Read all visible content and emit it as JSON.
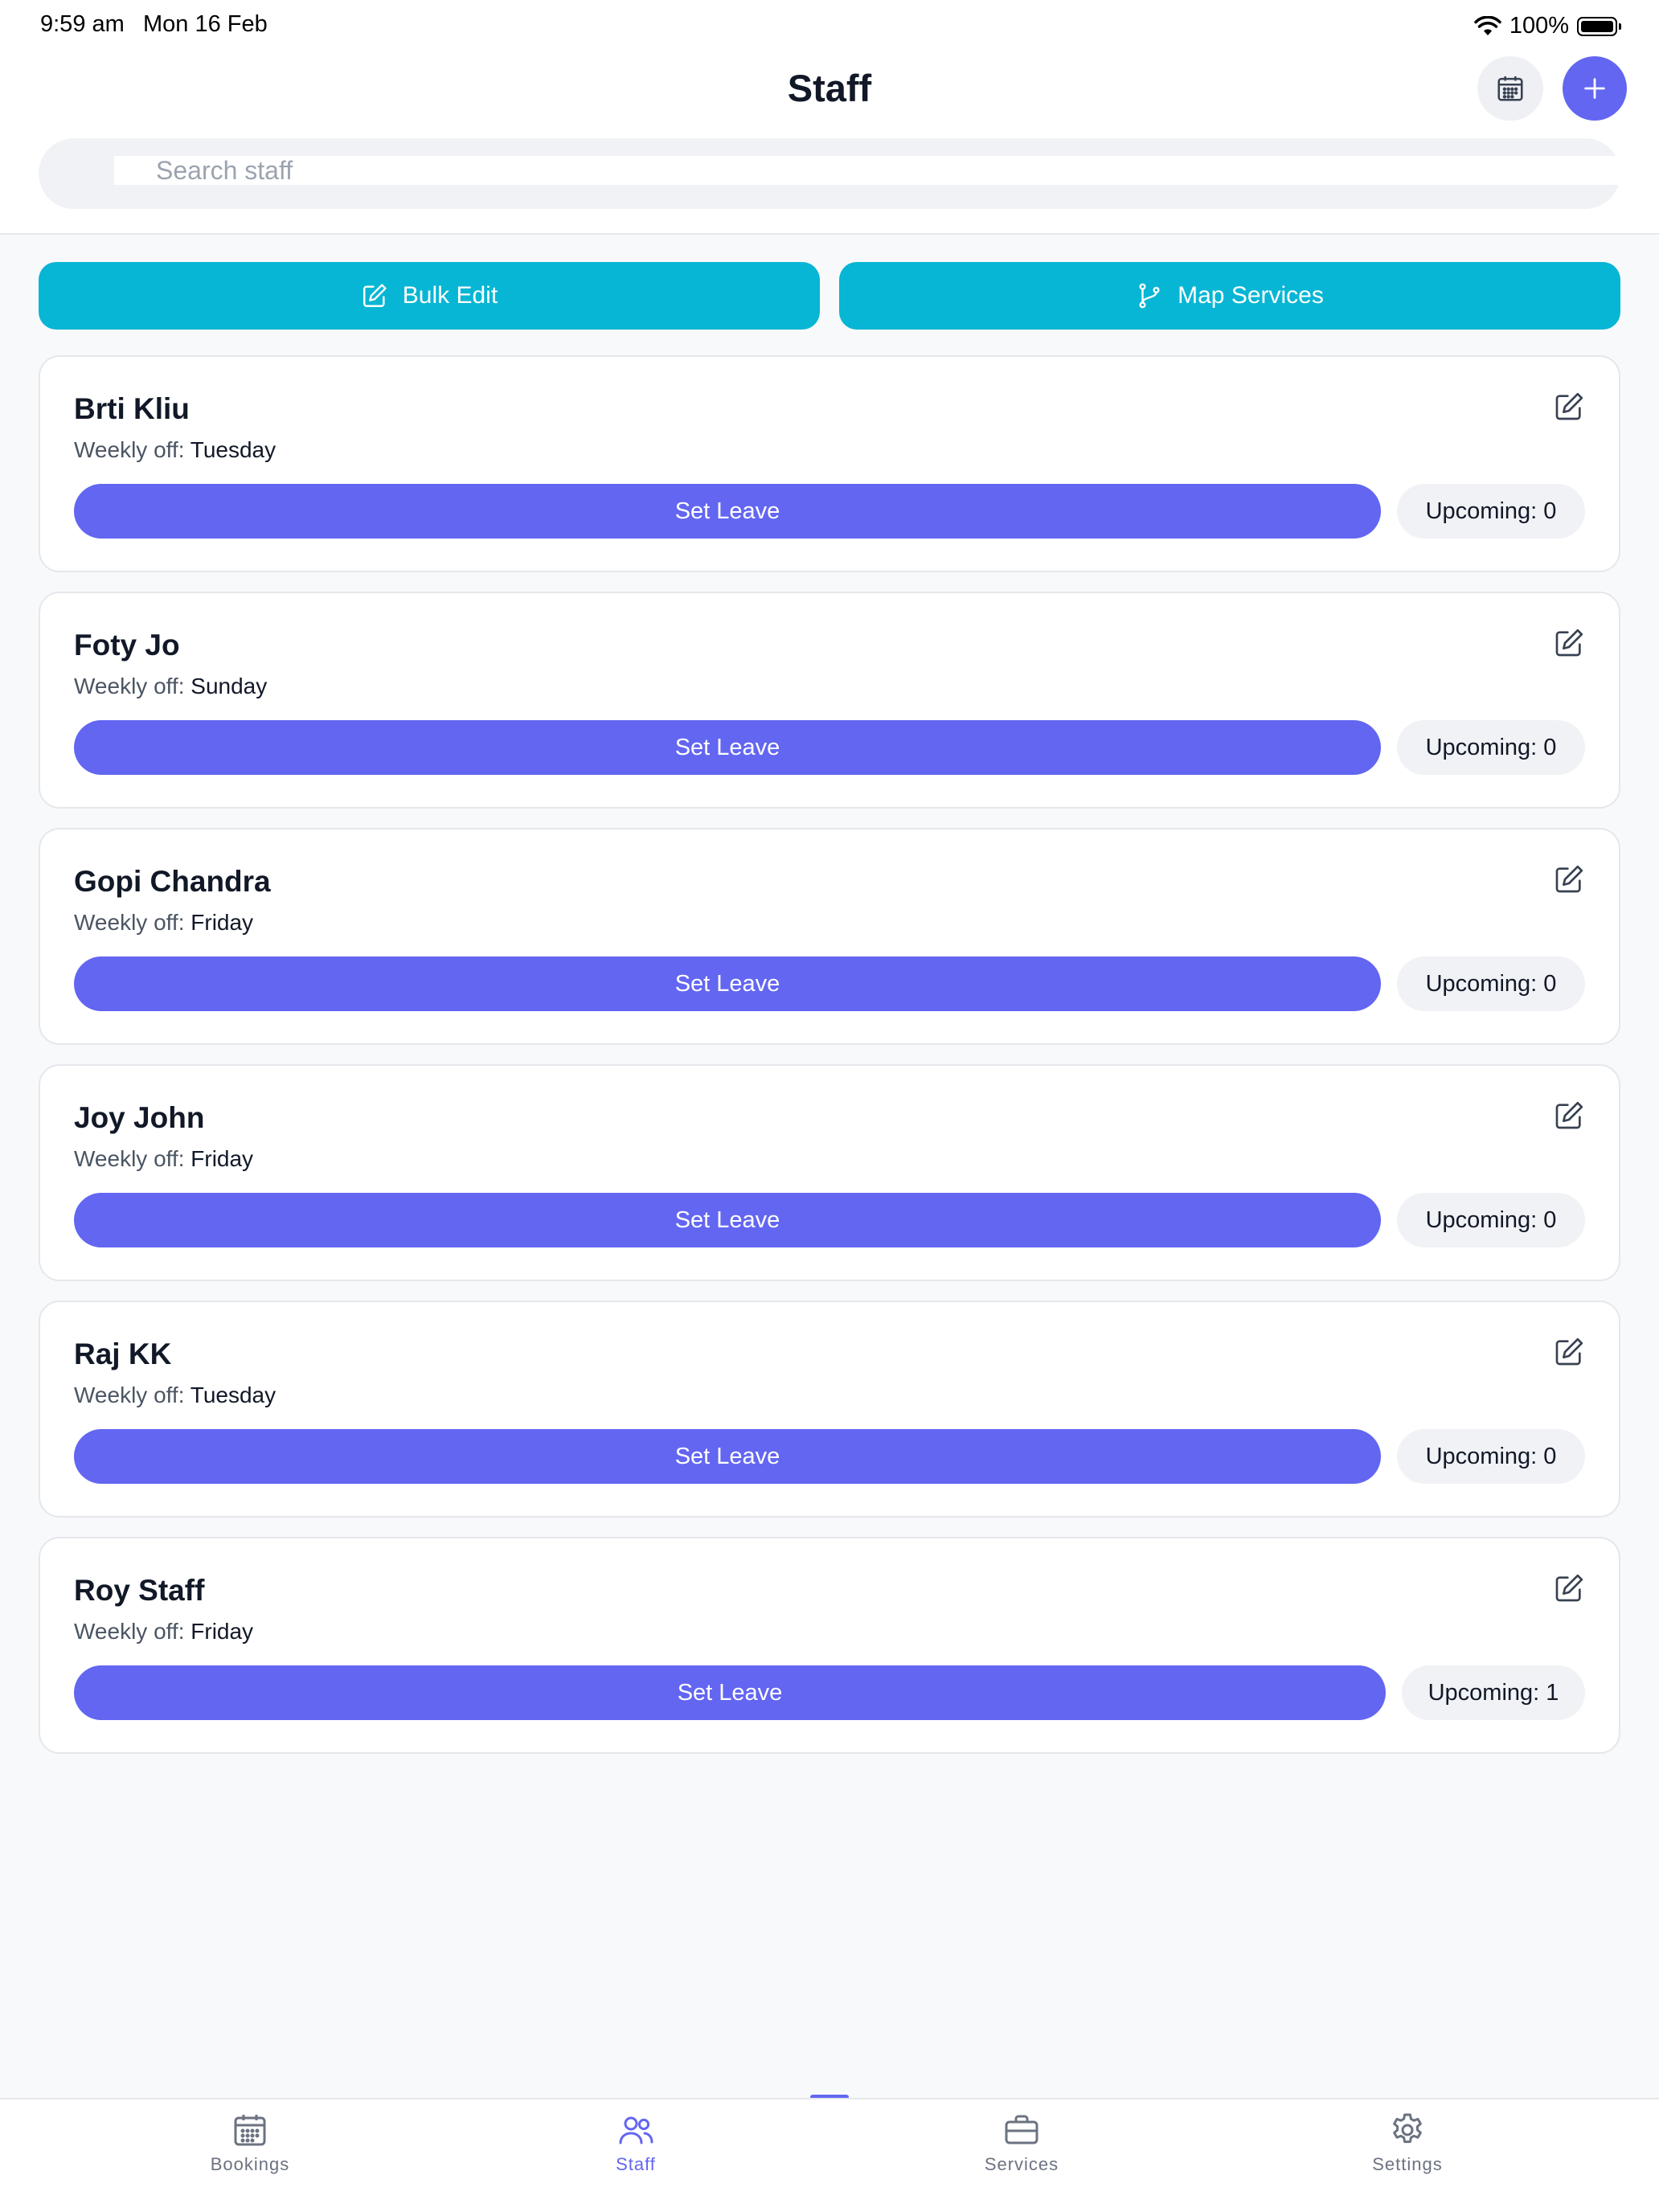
{
  "status": {
    "time": "9:59 am",
    "date": "Mon 16 Feb",
    "battery": "100%"
  },
  "header": {
    "title": "Staff"
  },
  "search": {
    "placeholder": "Search staff",
    "value": ""
  },
  "actions": {
    "bulk_edit": "Bulk Edit",
    "map_services": "Map Services"
  },
  "staff": [
    {
      "name": "Brti Kliu",
      "weekly_off_label": "Weekly off:",
      "weekly_off": "Tuesday",
      "set_leave": "Set Leave",
      "upcoming": "Upcoming: 0"
    },
    {
      "name": "Foty Jo",
      "weekly_off_label": "Weekly off:",
      "weekly_off": "Sunday",
      "set_leave": "Set Leave",
      "upcoming": "Upcoming: 0"
    },
    {
      "name": "Gopi Chandra",
      "weekly_off_label": "Weekly off:",
      "weekly_off": "Friday",
      "set_leave": "Set Leave",
      "upcoming": "Upcoming: 0"
    },
    {
      "name": "Joy John",
      "weekly_off_label": "Weekly off:",
      "weekly_off": "Friday",
      "set_leave": "Set Leave",
      "upcoming": "Upcoming: 0"
    },
    {
      "name": "Raj KK",
      "weekly_off_label": "Weekly off:",
      "weekly_off": "Tuesday",
      "set_leave": "Set Leave",
      "upcoming": "Upcoming: 0"
    },
    {
      "name": "Roy Staff",
      "weekly_off_label": "Weekly off:",
      "weekly_off": "Friday",
      "set_leave": "Set Leave",
      "upcoming": "Upcoming: 1"
    }
  ],
  "tabs": [
    {
      "label": "Bookings",
      "icon": "calendar-icon"
    },
    {
      "label": "Staff",
      "icon": "users-icon"
    },
    {
      "label": "Services",
      "icon": "briefcase-icon"
    },
    {
      "label": "Settings",
      "icon": "gear-icon"
    }
  ],
  "colors": {
    "primary": "#6366f1",
    "accent": "#06b6d4"
  }
}
